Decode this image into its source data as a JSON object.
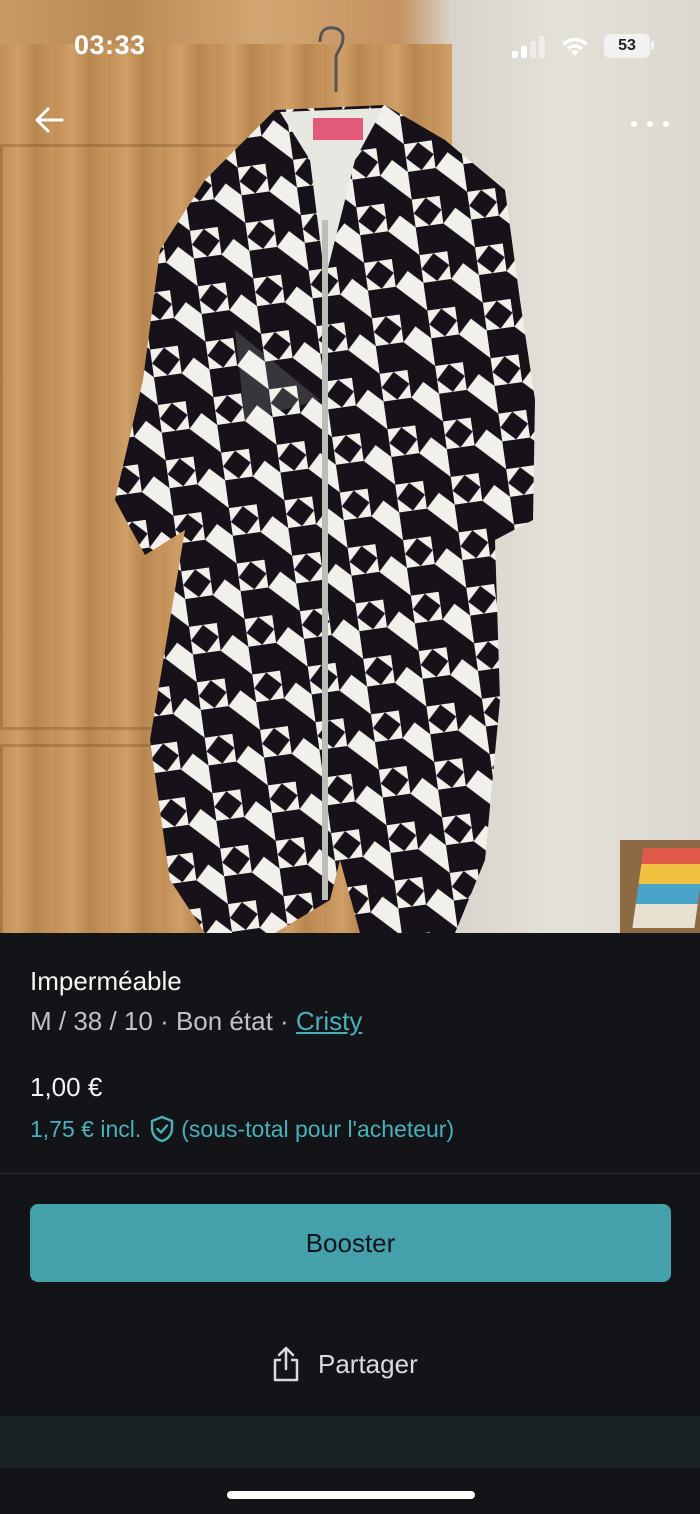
{
  "status_bar": {
    "time": "03:33",
    "battery": "53"
  },
  "product": {
    "title": "Imperméable",
    "details": "M / 38 / 10 · Bon état · ",
    "seller": "Cristy",
    "price": "1,00 €",
    "price_incl": "1,75 € incl.",
    "price_incl_note": "(sous-total pour l'acheteur)"
  },
  "actions": {
    "booster_label": "Booster",
    "share_label": "Partager"
  },
  "icons": {
    "back": "arrow-left-icon",
    "more": "more-horizontal-icon",
    "shield": "shield-check-icon",
    "share": "share-icon"
  },
  "colors": {
    "accent": "#44a1ab",
    "link": "#4ab0ba",
    "background": "#121418"
  }
}
